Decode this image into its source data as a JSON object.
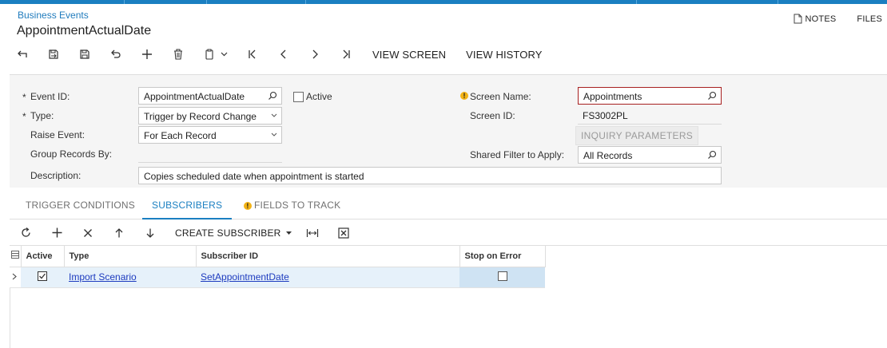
{
  "header": {
    "breadcrumb": "Business Events",
    "title": "AppointmentActualDate",
    "notes_label": "NOTES",
    "files_label": "FILES"
  },
  "toolbar": {
    "view_screen": "VIEW SCREEN",
    "view_history": "VIEW HISTORY"
  },
  "form": {
    "event_id_label": "Event ID:",
    "event_id_value": "AppointmentActualDate",
    "active_label": "Active",
    "type_label": "Type:",
    "type_value": "Trigger by Record Change",
    "raise_event_label": "Raise Event:",
    "raise_event_value": "For Each Record",
    "group_records_label": "Group Records By:",
    "description_label": "Description:",
    "description_value": "Copies scheduled date when appointment is started",
    "screen_name_label": "Screen Name:",
    "screen_name_value": "Appointments",
    "screen_id_label": "Screen ID:",
    "screen_id_value": "FS3002PL",
    "inquiry_params_label": "INQUIRY PARAMETERS",
    "shared_filter_label": "Shared Filter to Apply:",
    "shared_filter_value": "All Records",
    "required_mark": "*"
  },
  "tabs": [
    {
      "label": "TRIGGER CONDITIONS"
    },
    {
      "label": "SUBSCRIBERS"
    },
    {
      "label": "FIELDS TO TRACK"
    }
  ],
  "grid_toolbar": {
    "create_subscriber": "CREATE SUBSCRIBER"
  },
  "grid": {
    "columns": [
      "Active",
      "Type",
      "Subscriber ID",
      "Stop on Error"
    ],
    "rows": [
      {
        "active": true,
        "type": "Import Scenario",
        "subscriber_id": "SetAppointmentDate",
        "stop_on_error": false
      }
    ]
  },
  "colors": {
    "accent": "#1a7fc1",
    "link": "#1d3bbf",
    "warning": "#f3b316",
    "error_border": "#a72020",
    "selected_row": "#e6f1fa"
  }
}
